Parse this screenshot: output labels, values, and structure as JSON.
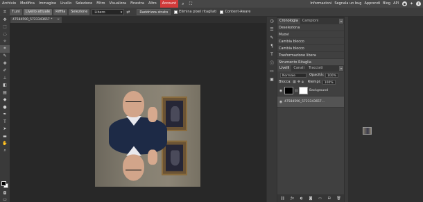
{
  "menu": {
    "items": [
      "Archivio",
      "Modifica",
      "Immagine",
      "Livello",
      "Selezione",
      "Filtro",
      "Visualizza",
      "Finestra",
      "Altro"
    ],
    "account": "Account",
    "right_links": [
      "Informazioni",
      "Segnala un bug",
      "Apprendi",
      "Blog",
      "API"
    ]
  },
  "options": {
    "transform_label": "T.uni",
    "level_label": "Livello attuale",
    "fill_label": "Riffila",
    "selection_label": "Selezione",
    "ratio_value": "Libero",
    "straighten_label": "Raddrizza strato",
    "delete_pixels_label": "Elimina pixel ritagliati",
    "content_aware_label": "Content-Aware"
  },
  "document": {
    "tab_title": "47584590_5723343657 *"
  },
  "history": {
    "tabs": [
      "Cronologia",
      "Campioni"
    ],
    "entries": [
      "Deseleziona",
      "Muovi",
      "Cambia blocco",
      "Cambia blocco",
      "Trasformazione libera",
      "Strumento Ritaglia"
    ]
  },
  "layers": {
    "tabs": [
      "Livelli",
      "Canali",
      "Tracciati"
    ],
    "blend_mode": "Normale",
    "opacity_label": "Opacità:",
    "opacity_value": "100%",
    "lock_label": "Blocca:",
    "fill_label": "Riempi:",
    "fill_value": "100%",
    "items": [
      {
        "name": "Background"
      },
      {
        "name": "47584590_5723343657..."
      }
    ]
  },
  "colors": {
    "accent": "#d13a3a"
  }
}
